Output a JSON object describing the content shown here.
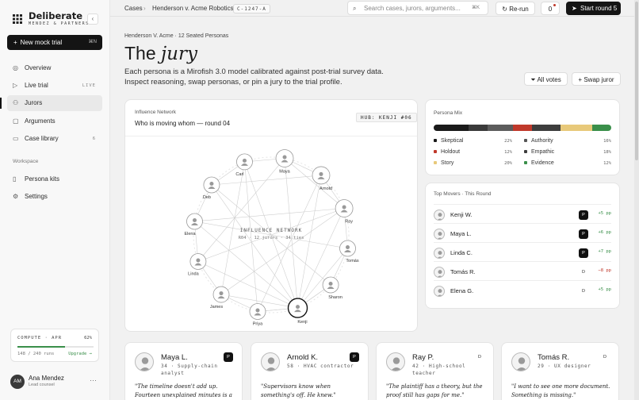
{
  "brand": {
    "name": "Deliberate",
    "sub": "MENDEZ & PARTNERS"
  },
  "sidebar": {
    "new_trial": "New mock trial",
    "new_trial_kbd": "⌘N",
    "items": [
      {
        "label": "Overview",
        "tag": ""
      },
      {
        "label": "Live trial",
        "tag": "LIVE"
      },
      {
        "label": "Jurors",
        "tag": ""
      },
      {
        "label": "Arguments",
        "tag": ""
      },
      {
        "label": "Case library",
        "tag": "6"
      }
    ],
    "workspace_label": "Workspace",
    "workspace_items": [
      {
        "label": "Persona kits"
      },
      {
        "label": "Settings"
      }
    ],
    "compute": {
      "title": "COMPUTE · APR",
      "pct": "62%",
      "level": 0.62,
      "runs": "148 / 240 runs",
      "upgrade": "Upgrade →"
    },
    "user": {
      "initials": "AM",
      "name": "Ana Mendez",
      "role": "Lead counsel"
    }
  },
  "topbar": {
    "crumbs": [
      "Cases",
      "Henderson v. Acme Robotics"
    ],
    "case_id": "C-1247-A",
    "search_placeholder": "Search cases, jurors, arguments...",
    "search_kbd": "⌘K",
    "rerun": "Re-run",
    "notif_count": "0",
    "start": "Start round 5"
  },
  "page": {
    "subheader": "Henderson V. Acme · 12 Seated Personas",
    "title_plain": "The ",
    "title_italic": "jury",
    "desc": "Each persona is a Mirofish 3.0 model calibrated against post-trial survey data. Inspect reasoning, swap personas, or pin a jury to the trial profile.",
    "all_votes": "All votes",
    "swap": "Swap juror"
  },
  "network": {
    "heading": "Influence Network",
    "subtitle": "Who is moving whom — round 04",
    "hub": "HUB: KENJI #06",
    "center_title": "INFLUENCE NETWORK",
    "center_sub": "R04 · 12 jurors · 34 ties",
    "nodes": [
      "Maya",
      "Arnold",
      "Ray",
      "Tomás",
      "Sharon",
      "Kenji",
      "Priya",
      "James",
      "Linda",
      "Elena",
      "Deb",
      "Carl"
    ]
  },
  "mix": {
    "heading": "Persona Mix",
    "colors": [
      "#1a1a1a",
      "#3a3a3a",
      "#5c5c5c",
      "#c0392b",
      "#3d3d3d",
      "#e8c97a",
      "#3a8f4a"
    ],
    "legend": [
      {
        "label": "Skeptical",
        "value": "22%",
        "color": "#1a1a1a"
      },
      {
        "label": "Authority",
        "value": "16%",
        "color": "#555555"
      },
      {
        "label": "Holdout",
        "value": "12%",
        "color": "#c0392b"
      },
      {
        "label": "Empathic",
        "value": "18%",
        "color": "#3d3d3d"
      },
      {
        "label": "Story",
        "value": "20%",
        "color": "#e8c97a"
      },
      {
        "label": "Evidence",
        "value": "12%",
        "color": "#3a8f4a"
      }
    ]
  },
  "movers": {
    "heading": "Top Movers · This Round",
    "rows": [
      {
        "name": "Kenji W.",
        "badge": "P",
        "delta": "+5 pp"
      },
      {
        "name": "Maya L.",
        "badge": "P",
        "delta": "+6 pp"
      },
      {
        "name": "Linda C.",
        "badge": "P",
        "delta": "+7 pp"
      },
      {
        "name": "Tomás R.",
        "badge": "D",
        "delta": "−8 pp"
      },
      {
        "name": "Elena G.",
        "badge": "D",
        "delta": "+5 pp"
      }
    ]
  },
  "jurors": [
    {
      "name": "Maya L.",
      "meta": "34 · Supply-chain analyst",
      "badge": "P",
      "quote": "\"The timeline doesn't add up. Fourteen unexplained minutes is a lot.\""
    },
    {
      "name": "Arnold K.",
      "meta": "58 · HVAC contractor",
      "badge": "P",
      "quote": "\"Supervisors know when something's off. He knew.\""
    },
    {
      "name": "Ray P.",
      "meta": "42 · High-school teacher",
      "badge": "D",
      "quote": "\"The plaintiff has a theory, but the proof still has gaps for me.\""
    },
    {
      "name": "Tomás R.",
      "meta": "29 · UX designer",
      "badge": "D",
      "quote": "\"I want to see one more document. Something is missing.\""
    }
  ]
}
